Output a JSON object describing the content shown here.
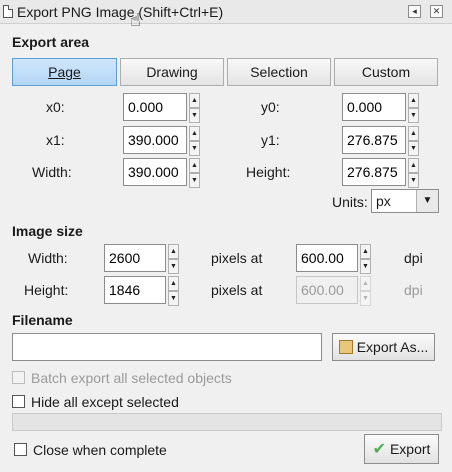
{
  "window": {
    "title": "Export PNG Image (Shift+Ctrl+E)",
    "buttons": [
      "dock-icon",
      "close-icon"
    ]
  },
  "export_area": {
    "heading": "Export area",
    "tabs": [
      {
        "label": "Page",
        "active": true
      },
      {
        "label": "Drawing",
        "active": false
      },
      {
        "label": "Selection",
        "active": false
      },
      {
        "label": "Custom",
        "active": false
      }
    ],
    "x0_label": "x0:",
    "x0": "0.000",
    "y0_label": "y0:",
    "y0": "0.000",
    "x1_label": "x1:",
    "x1": "390.000",
    "y1_label": "y1:",
    "y1": "276.875",
    "width_label": "Width:",
    "width": "390.000",
    "height_label": "Height:",
    "height": "276.875",
    "units_label": "Units:",
    "units": "px"
  },
  "image_size": {
    "heading": "Image size",
    "width_label": "Width:",
    "width": "2600",
    "height_label": "Height:",
    "height": "1846",
    "pixels_at_1": "pixels at",
    "dpi_1": "600.00",
    "dpi_label_1": "dpi",
    "pixels_at_2": "pixels at",
    "dpi_2": "600.00",
    "dpi_label_2": "dpi"
  },
  "filename": {
    "heading": "Filename",
    "value": "",
    "export_as_label": "Export As..."
  },
  "options": {
    "batch_export": "Batch export all selected objects",
    "hide_all": "Hide all except selected",
    "close_when_complete": "Close when complete"
  },
  "progress": 0,
  "export_button": "Export",
  "colors": {
    "tab_active": "#b4d6f6",
    "export_icon": "#4caf50"
  }
}
